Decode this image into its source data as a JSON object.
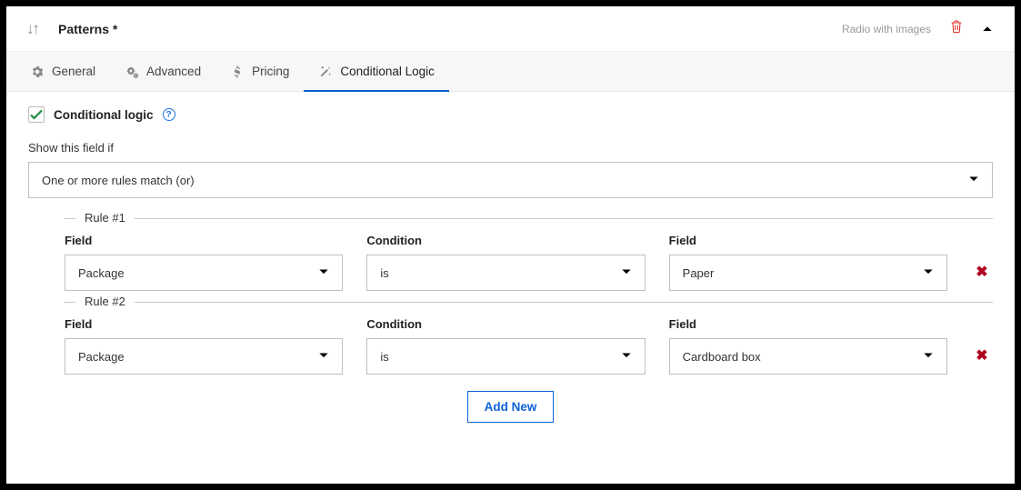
{
  "header": {
    "title": "Patterns *",
    "type_label": "Radio with images"
  },
  "tabs": {
    "general": "General",
    "advanced": "Advanced",
    "pricing": "Pricing",
    "conditional": "Conditional Logic"
  },
  "enable": {
    "label": "Conditional logic"
  },
  "show_label": "Show this field if",
  "match_mode": "One or more rules match (or)",
  "labels": {
    "field": "Field",
    "condition": "Condition",
    "value": "Field"
  },
  "rules": [
    {
      "legend": "Rule #1",
      "field": "Package",
      "condition": "is",
      "value": "Paper"
    },
    {
      "legend": "Rule #2",
      "field": "Package",
      "condition": "is",
      "value": "Cardboard box"
    }
  ],
  "add_new": "Add New"
}
